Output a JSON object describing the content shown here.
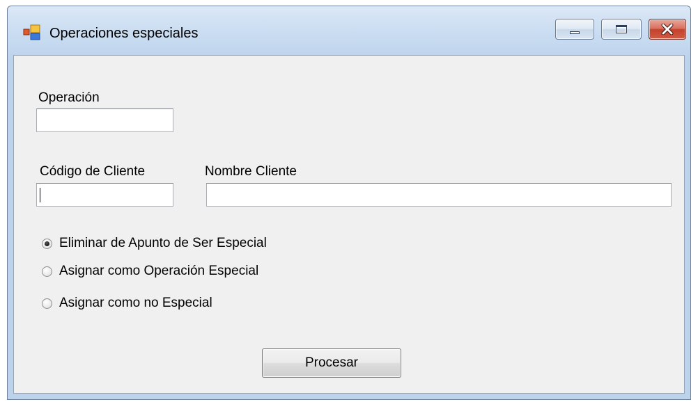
{
  "window": {
    "title": "Operaciones especiales",
    "icon": "app-window-icon",
    "controls": {
      "minimize_icon": "minimize-icon",
      "maximize_icon": "maximize-icon",
      "close_icon": "close-icon"
    }
  },
  "form": {
    "operacion": {
      "label": "Operación",
      "value": ""
    },
    "codigo_cliente": {
      "label": "Código de Cliente",
      "value": "",
      "focused": true
    },
    "nombre_cliente": {
      "label": "Nombre Cliente",
      "value": ""
    },
    "options": [
      {
        "label": "Eliminar de Apunto de Ser Especial",
        "checked": true
      },
      {
        "label": "Asignar como Operación Especial",
        "checked": false
      },
      {
        "label": "Asignar como no Especial",
        "checked": false
      }
    ],
    "submit_label": "Procesar"
  },
  "colors": {
    "client_background": "#f0f0f0",
    "close_button": "#c4422d",
    "frame": "#bdd3ec"
  }
}
